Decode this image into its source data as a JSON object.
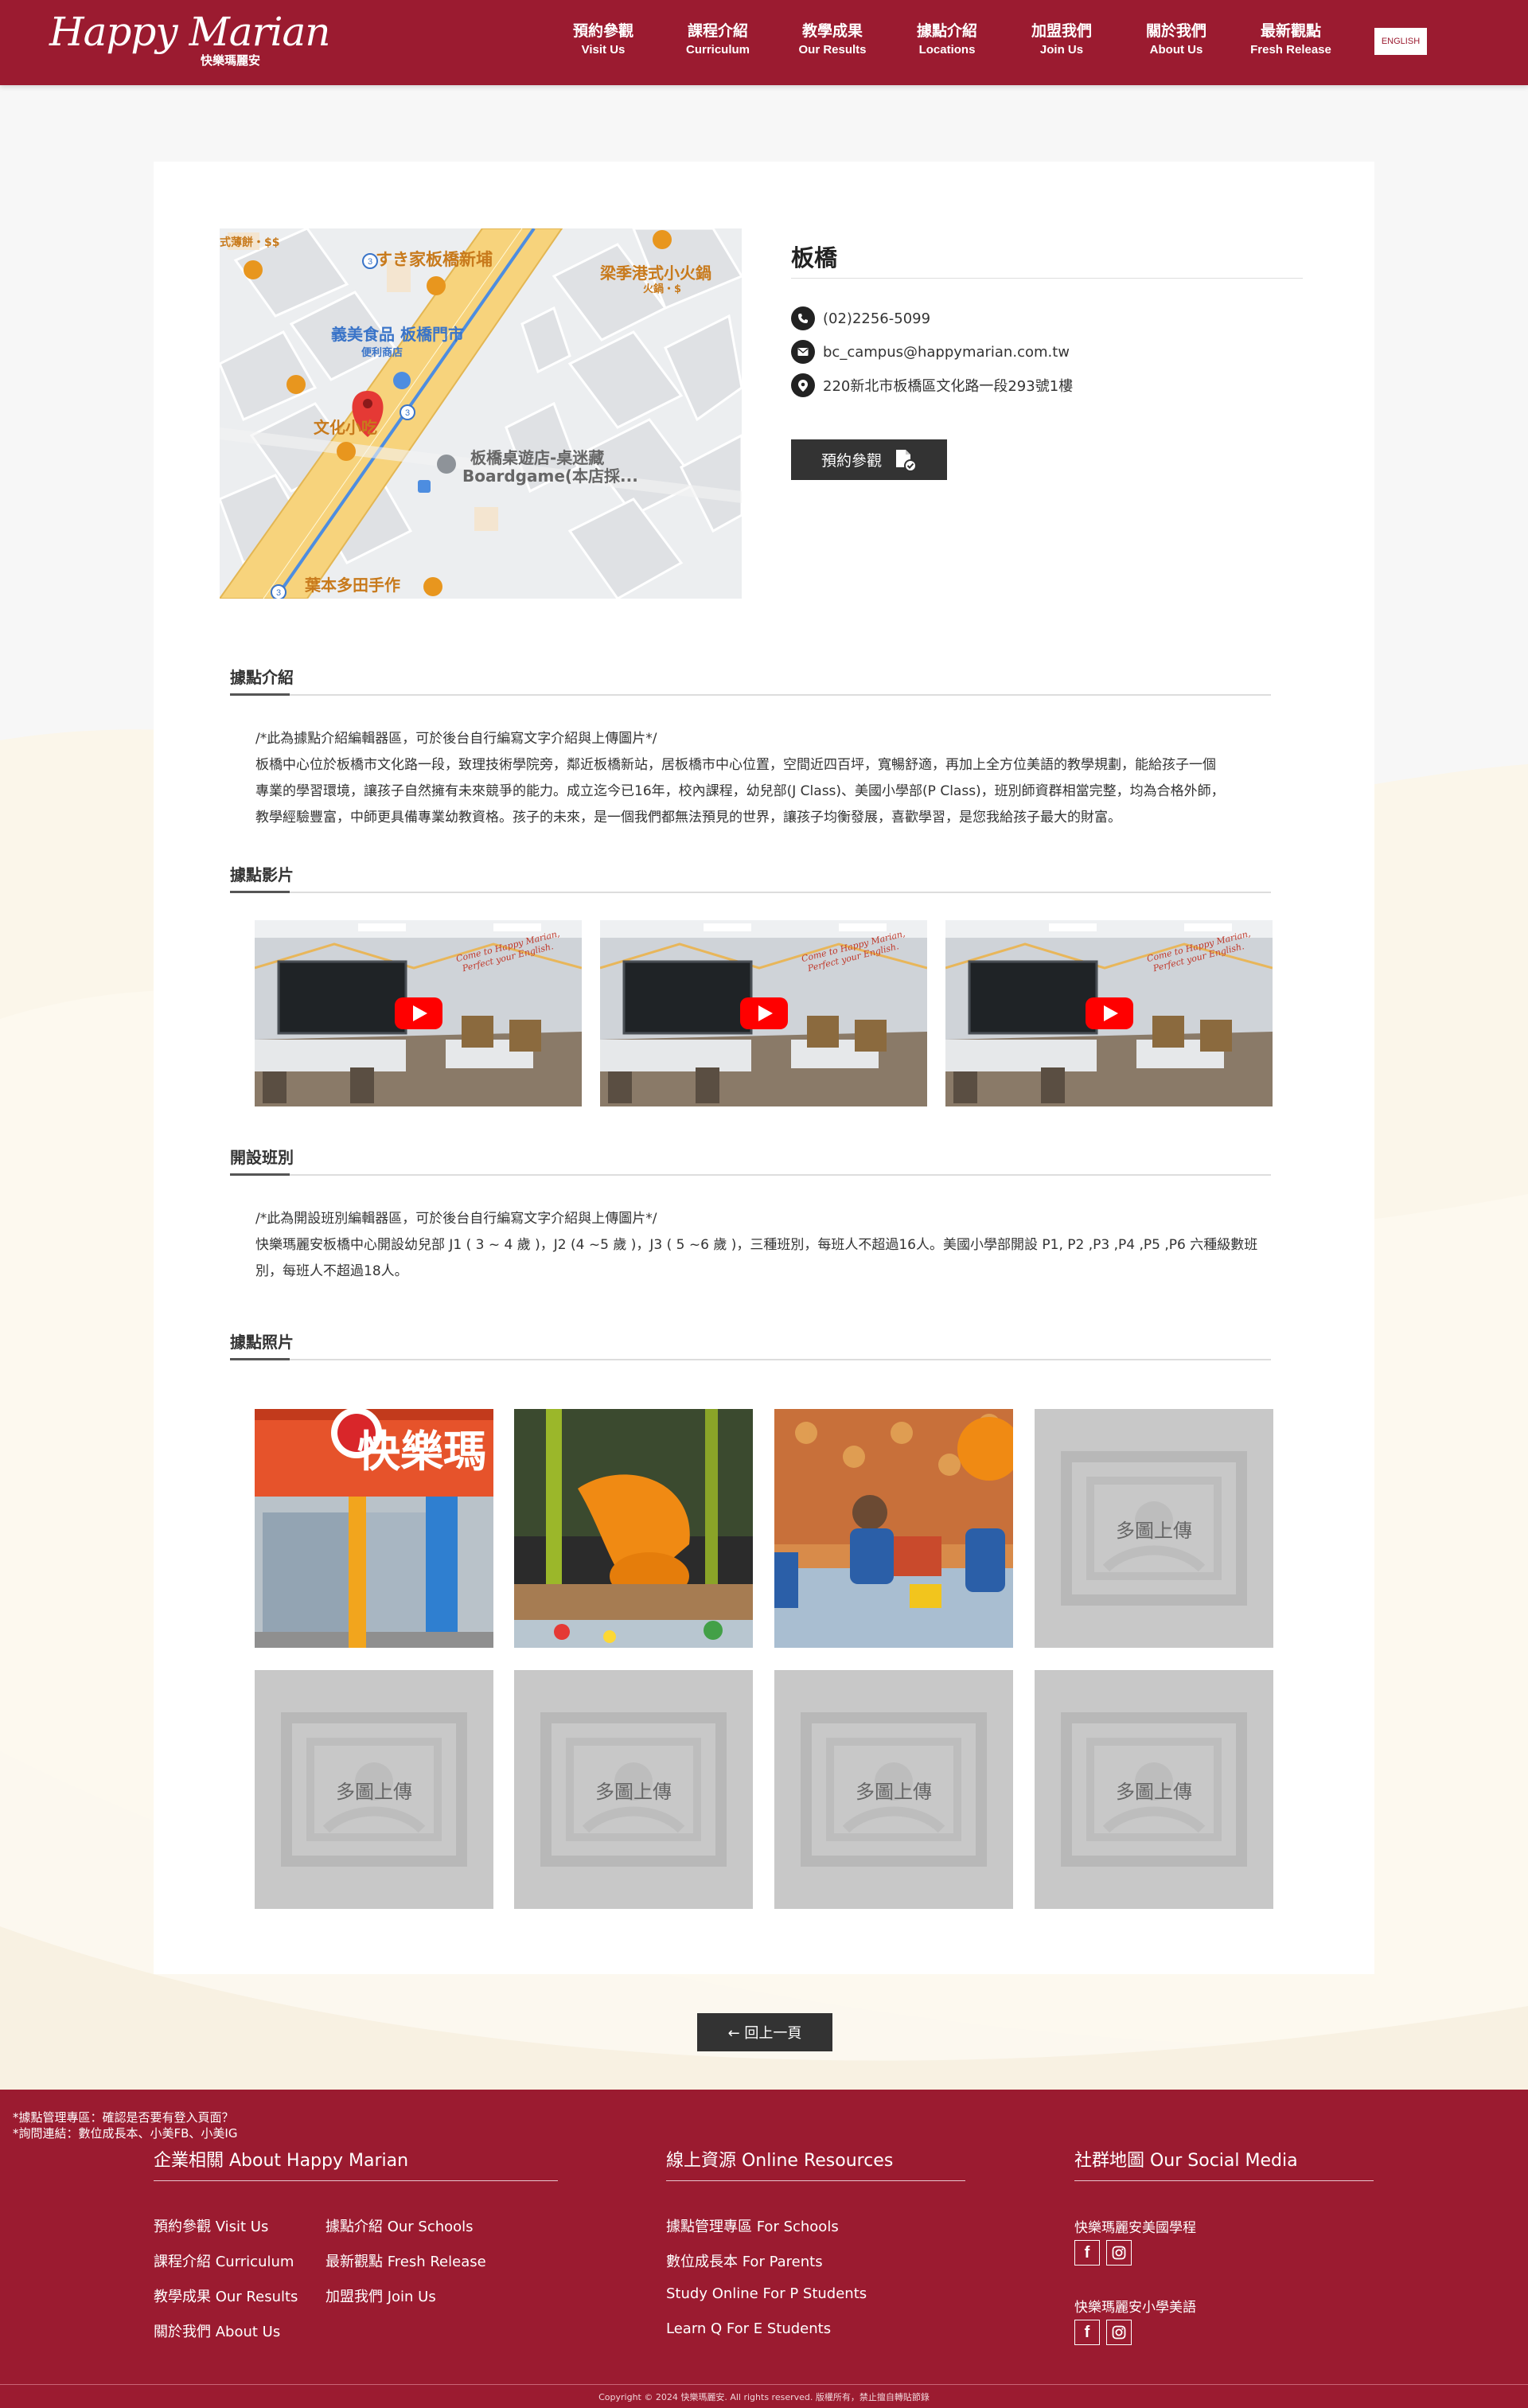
{
  "header": {
    "logo_main": "Happy Marian",
    "logo_sub": "快樂瑪麗安",
    "nav": [
      {
        "zh": "預約參觀",
        "en": "Visit Us"
      },
      {
        "zh": "課程介紹",
        "en": "Curriculum"
      },
      {
        "zh": "教學成果",
        "en": "Our Results"
      },
      {
        "zh": "據點介紹",
        "en": "Locations"
      },
      {
        "zh": "加盟我們",
        "en": "Join Us"
      },
      {
        "zh": "關於我們",
        "en": "About Us"
      },
      {
        "zh": "最新觀點",
        "en": "Fresh Release"
      }
    ],
    "lang_button": "ENGLISH"
  },
  "map": {
    "labels": [
      "すき家板橋新埔",
      "梁季港式小火鍋",
      "火鍋・$",
      "義美食品 板橋門市",
      "便利商店",
      "文化小吃",
      "板橋桌遊店-桌迷藏",
      "Boardgame(本店採...",
      "葉本多田手作",
      "式薄餅・$$",
      "3",
      "3",
      "3"
    ]
  },
  "campus": {
    "name": "板橋",
    "phone": "(02)2256-5099",
    "email": "bc_campus@happymarian.com.tw",
    "address": "220新北市板橋區文化路一段293號1樓",
    "visit_button": "預約參觀"
  },
  "sections": {
    "intro_title": "據點介紹",
    "intro_lines": [
      "/*此為據點介紹編輯器區，可於後台自行編寫文字介紹與上傳圖片*/",
      "板橋中心位於板橋市文化路一段，致理技術學院旁，鄰近板橋新站，居板橋市中心位置，空間近四百坪，寬暢舒適，再加上全方位美語的教學規劃，能給孩子一個",
      "專業的學習環境，讓孩子自然擁有未來競爭的能力。成立迄今已16年，校內課程，幼兒部(J Class)、美國小學部(P Class)，班別師資群相當完整，均為合格外師，",
      "教學經驗豐富，中師更具備專業幼教資格。孩子的未來，是一個我們都無法預見的世界，讓孩子均衡發展，喜歡學習，是您我給孩子最大的財富。"
    ],
    "video_title": "據點影片",
    "video_wall_text": [
      "Come to Happy Marian,",
      "Perfect your English."
    ],
    "class_title": "開設班別",
    "class_lines": [
      "/*此為開設班別編輯器區，可於後台自行編寫文字介紹與上傳圖片*/",
      "快樂瑪麗安板橋中心開設幼兒部 J1 ( 3 ~ 4 歲 )，J2 (4 ~5 歲 )，J3 ( 5 ~6 歲 )，三種班別，每班人不超過16人。美國小學部開設 P1, P2 ,P3 ,P4 ,P5 ,P6 六種級數班",
      "別，每班人不超過18人。"
    ],
    "photo_title": "據點照片",
    "placeholder_label": "多圖上傳",
    "store_sign": "快樂瑪"
  },
  "back_button": "← 回上一頁",
  "footer": {
    "notes": [
      "*據點管理專區：確認是否要有登入頁面？",
      "*詢問連結：數位成長本、小美FB、小美IG"
    ],
    "about_title": "企業相關 About Happy Marian",
    "about_links": [
      "預約參觀  Visit Us",
      "課程介紹  Curriculum",
      "教學成果  Our Results",
      "關於我們  About Us",
      "據點介紹  Our Schools",
      "最新觀點  Fresh Release",
      "加盟我們  Join Us"
    ],
    "resources_title": "線上資源 Online Resources",
    "resources_links": [
      "據點管理專區  For Schools",
      "數位成長本  For Parents",
      "Study Online  For P Students",
      "Learn Q  For E Students"
    ],
    "social_title": "社群地圖 Our Social Media",
    "social_groups": [
      "快樂瑪麗安美國學程",
      "快樂瑪麗安小學美語"
    ],
    "copyright": "Copyright © 2024 快樂瑪麗安. All rights reserved. 版權所有，禁止擅自轉貼節錄"
  },
  "colors": {
    "brand": "#9b1b30",
    "dark_button": "#333333",
    "map_road": "#f7d37c",
    "placeholder": "#c8c8c8"
  }
}
